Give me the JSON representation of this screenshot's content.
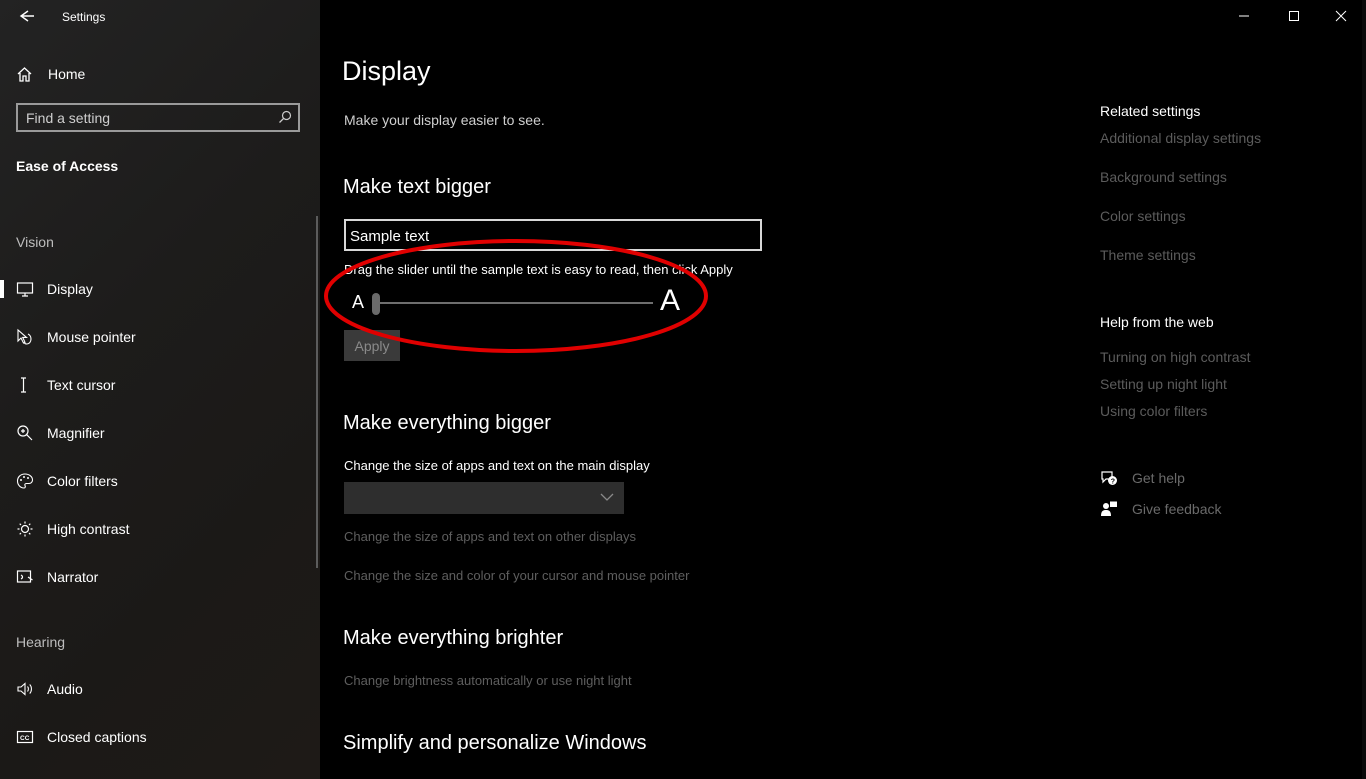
{
  "window": {
    "title": "Settings"
  },
  "sidebar": {
    "home_label": "Home",
    "search_placeholder": "Find a setting",
    "section_title": "Ease of Access",
    "vision_label": "Vision",
    "vision_items": [
      {
        "label": "Display",
        "icon": "monitor-icon",
        "active": true
      },
      {
        "label": "Mouse pointer",
        "icon": "mouse-pointer-icon"
      },
      {
        "label": "Text cursor",
        "icon": "text-cursor-icon"
      },
      {
        "label": "Magnifier",
        "icon": "magnifier-icon"
      },
      {
        "label": "Color filters",
        "icon": "color-filters-icon"
      },
      {
        "label": "High contrast",
        "icon": "high-contrast-icon"
      },
      {
        "label": "Narrator",
        "icon": "narrator-icon"
      }
    ],
    "hearing_label": "Hearing",
    "hearing_items": [
      {
        "label": "Audio",
        "icon": "audio-icon"
      },
      {
        "label": "Closed captions",
        "icon": "closed-captions-icon"
      }
    ]
  },
  "main": {
    "title": "Display",
    "description": "Make your display easier to see.",
    "text_bigger": {
      "heading": "Make text bigger",
      "sample_text": "Sample text",
      "hint": "Drag the slider until the sample text is easy to read, then click Apply",
      "small_a": "A",
      "big_a": "A",
      "slider_value": 0,
      "apply_label": "Apply"
    },
    "everything_bigger": {
      "heading": "Make everything bigger",
      "label": "Change the size of apps and text on the main display",
      "dropdown_value": "",
      "link_other_displays": "Change the size of apps and text on other displays",
      "link_cursor": "Change the size and color of your cursor and mouse pointer"
    },
    "everything_brighter": {
      "heading": "Make everything brighter",
      "link": "Change brightness automatically or use night light"
    },
    "simplify": {
      "heading": "Simplify and personalize Windows"
    }
  },
  "related": {
    "heading": "Related settings",
    "links": [
      "Additional display settings",
      "Background settings",
      "Color settings",
      "Theme settings"
    ],
    "help_heading": "Help from the web",
    "help_links": [
      "Turning on high contrast",
      "Setting up night light",
      "Using color filters"
    ],
    "get_help": "Get help",
    "give_feedback": "Give feedback"
  },
  "colors": {
    "annotation": "#e00000",
    "background": "#000000"
  }
}
